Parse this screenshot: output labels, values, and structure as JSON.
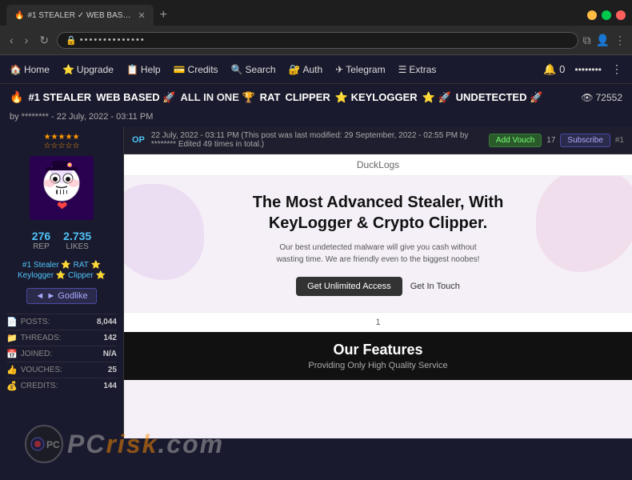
{
  "browser": {
    "tab_title": "#1 STEALER ✓ WEB BASED 🚀 ...",
    "tab_favicon": "🔒",
    "address_url": "••••••••••••••",
    "new_tab_label": "+",
    "nav_back": "‹",
    "nav_forward": "›",
    "nav_refresh": "↻"
  },
  "forum_nav": {
    "items": [
      {
        "label": "Home",
        "icon": "🏠"
      },
      {
        "label": "Upgrade",
        "icon": "⭐"
      },
      {
        "label": "Help",
        "icon": "📋"
      },
      {
        "label": "Credits",
        "icon": "💳"
      },
      {
        "label": "Search",
        "icon": "🔍"
      },
      {
        "label": "Auth",
        "icon": "🔐"
      },
      {
        "label": "Telegram",
        "icon": "✈"
      },
      {
        "label": "Extras",
        "icon": "☰"
      }
    ],
    "notification_icon": "🔔",
    "notification_count": "0",
    "username": "••••••••",
    "menu_icon": "⋮"
  },
  "thread": {
    "title_parts": {
      "icon": "🔥",
      "stealer": "#1 STEALER",
      "webbased": "WEB BASED 🚀",
      "allinone": "ALL IN ONE 🏆",
      "rat": "RAT",
      "clipper": "CLIPPER",
      "keylogger": "⭐ KEYLOGGER",
      "stars": "⭐ 🚀",
      "undetected": "UNDETECTED 🚀"
    },
    "views_icon": "👁",
    "views_count": "72552",
    "author": "by ******** - 22 July, 2022 - 03:11 PM"
  },
  "post": {
    "op_label": "OP",
    "date": "22 July, 2022 - 03:11 PM (This post was last modified: 29 September, 2022 - 02:55 PM by ******** Edited 49 times in total.)",
    "add_vouch_label": "Add Vouch",
    "vouch_count": "17",
    "subscribe_label": "Subscribe",
    "post_num": "#1"
  },
  "user": {
    "stars": "★★★★★",
    "rating_stars": "☆☆☆☆☆",
    "avatar_emoji": "💀❤️",
    "rep_value": "276",
    "rep_label": "REP",
    "likes_value": "2.735",
    "likes_label": "LIKES",
    "badge1": "#1 Stealer ⭐ RAT ⭐",
    "badge2": "Keylogger ⭐ Clipper ⭐",
    "rank": "◄ ► Godlike",
    "posts_label": "POSTS:",
    "posts_value": "8,044",
    "threads_label": "THREADS:",
    "threads_value": "142",
    "joined_label": "JOINED:",
    "joined_value": "N/A",
    "vouches_label": "VOUCHES:",
    "vouches_value": "25",
    "credits_label": "CREDITS:",
    "credits_value": "144"
  },
  "ducklogs_site": {
    "logo": "DuckLogs",
    "hero_title": "The Most Advanced Stealer, With\nKeyLogger & Crypto Clipper.",
    "hero_subtitle": "Our best undetected malware will give you cash without wasting time. We are friendly even to the biggest noobes!",
    "btn_access": "Get Unlimited Access",
    "btn_touch": "Get In Touch",
    "page_num": "1",
    "features_title": "Our Features",
    "features_subtitle": "Providing Only High Quality Service"
  },
  "watermark": {
    "text_part1": "PC",
    "text_part2": "risk",
    "text_part3": ".com"
  }
}
